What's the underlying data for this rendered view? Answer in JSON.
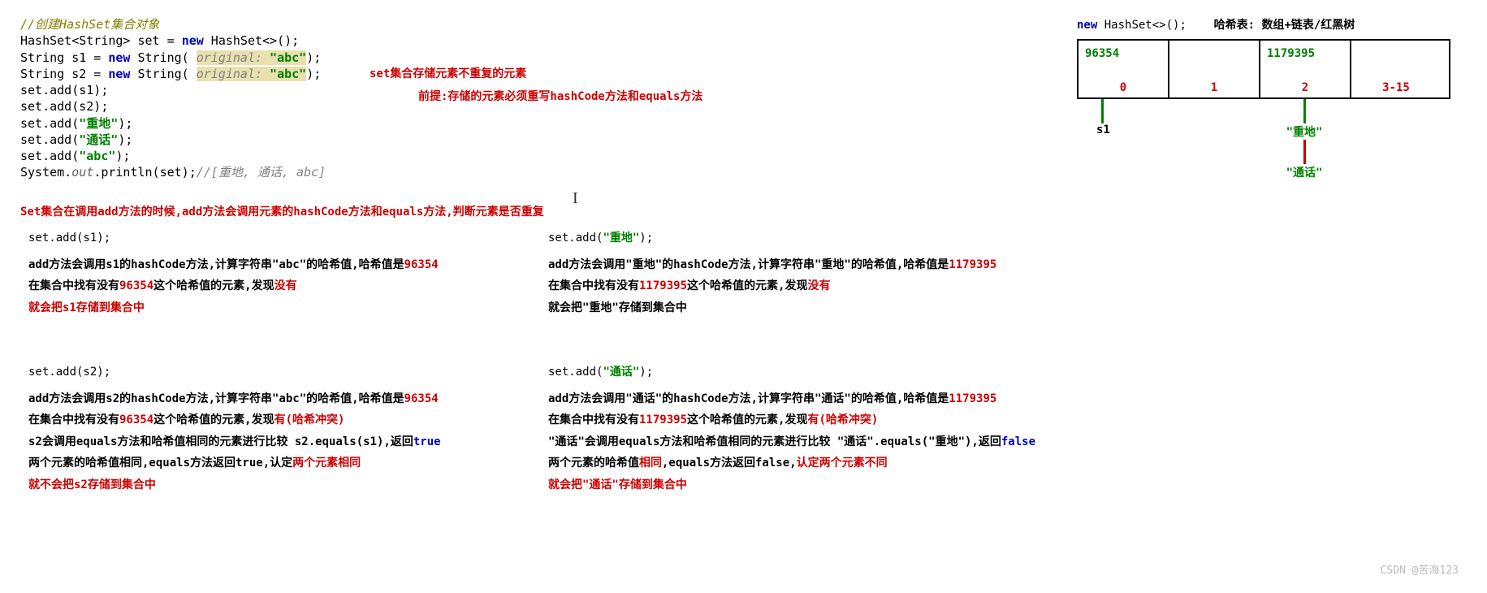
{
  "code": {
    "line1": "//创建HashSet集合对象",
    "line2a": "HashSet<String> set = ",
    "line2b": "new",
    "line2c": " HashSet<>();",
    "line3a": "String s1 = ",
    "line3b": "new",
    "line3c": " String( ",
    "line3d": "original:",
    "line3e": " \"abc\"",
    "line3f": ");",
    "line4a": "String s2 = ",
    "line4b": "new",
    "line4c": " String( ",
    "line4d": "original:",
    "line4e": " \"abc\"",
    "line4f": ");",
    "line5": "set.add(s1);",
    "line6": "set.add(s2);",
    "line7a": "set.add(",
    "line7b": "\"重地\"",
    "line7c": ");",
    "line8a": "set.add(",
    "line8b": "\"通话\"",
    "line8c": ");",
    "line9a": "set.add(",
    "line9b": "\"abc\"",
    "line9c": ");",
    "line10a": "System.",
    "line10b": "out",
    "line10c": ".println(set);",
    "line10d": "//[重地, 通话, abc]"
  },
  "ann_top1": "set集合存储元素不重复的元素",
  "ann_top2": "前提:存储的元素必须重写hashCode方法和equals方法",
  "sub_red": "Set集合在调用add方法的时候,add方法会调用元素的hashCode方法和equals方法,判断元素是否重复",
  "left1": {
    "code": "set.add(s1);",
    "l1a": "add方法会调用s1的hashCode方法,计算字符串\"abc\"的哈希值,哈希值是",
    "l1b": "96354",
    "l2a": "在集合中找有没有",
    "l2b": "96354",
    "l2c": "这个哈希值的元素,发现",
    "l2d": "没有",
    "l3": "就会把s1存储到集合中"
  },
  "left2": {
    "code": "set.add(s2);",
    "l1a": "add方法会调用s2的hashCode方法,计算字符串\"abc\"的哈希值,哈希值是",
    "l1b": "96354",
    "l2a": "在集合中找有没有",
    "l2b": "96354",
    "l2c": "这个哈希值的元素,发现",
    "l2d": "有(哈希冲突)",
    "l3a": "s2会调用equals方法和哈希值相同的元素进行比较 s2.equals(s1),返回",
    "l3b": "true",
    "l4a": "两个元素的哈希值相同,equals方法返回true,认定",
    "l4b": "两个元素相同",
    "l5": "就不会把s2存储到集合中"
  },
  "right1": {
    "code_a": "set.add(",
    "code_b": "\"重地\"",
    "code_c": ");",
    "l1a": "add方法会调用\"重地\"的hashCode方法,计算字符串\"重地\"的哈希值,哈希值是",
    "l1b": "1179395",
    "l2a": "在集合中找有没有",
    "l2b": "1179395",
    "l2c": "这个哈希值的元素,发现",
    "l2d": "没有",
    "l3": "就会把\"重地\"存储到集合中"
  },
  "right2": {
    "code_a": "set.add(",
    "code_b": "\"通话\"",
    "code_c": ");",
    "l1a": "add方法会调用\"通话\"的hashCode方法,计算字符串\"通话\"的哈希值,哈希值是",
    "l1b": "1179395",
    "l2a": "在集合中找有没有",
    "l2b": "1179395",
    "l2c": "这个哈希值的元素,发现",
    "l2d": "有(哈希冲突)",
    "l3a": "\"通话\"会调用equals方法和哈希值相同的元素进行比较 \"通话\".equals(\"重地\"),返回",
    "l3b": "false",
    "l4a": "两个元素的哈希值",
    "l4b": "相同",
    "l4c": ",equals方法返回false,",
    "l4d": "认定两个元素不同",
    "l5": "就会把\"通话\"存储到集合中"
  },
  "diagram": {
    "top_a": "new",
    "top_b": " HashSet<>();",
    "top_c": "哈希表: 数组+链表/红黑树",
    "cells": [
      {
        "val": "96354",
        "idx": "0"
      },
      {
        "val": "",
        "idx": "1"
      },
      {
        "val": "1179395",
        "idx": "2"
      },
      {
        "val": "",
        "idx": "3-15"
      }
    ],
    "node1": "s1",
    "node2": "\"重地\"",
    "node3": "\"通话\""
  },
  "watermark": "CSDN @苦海123",
  "cursor": "I"
}
